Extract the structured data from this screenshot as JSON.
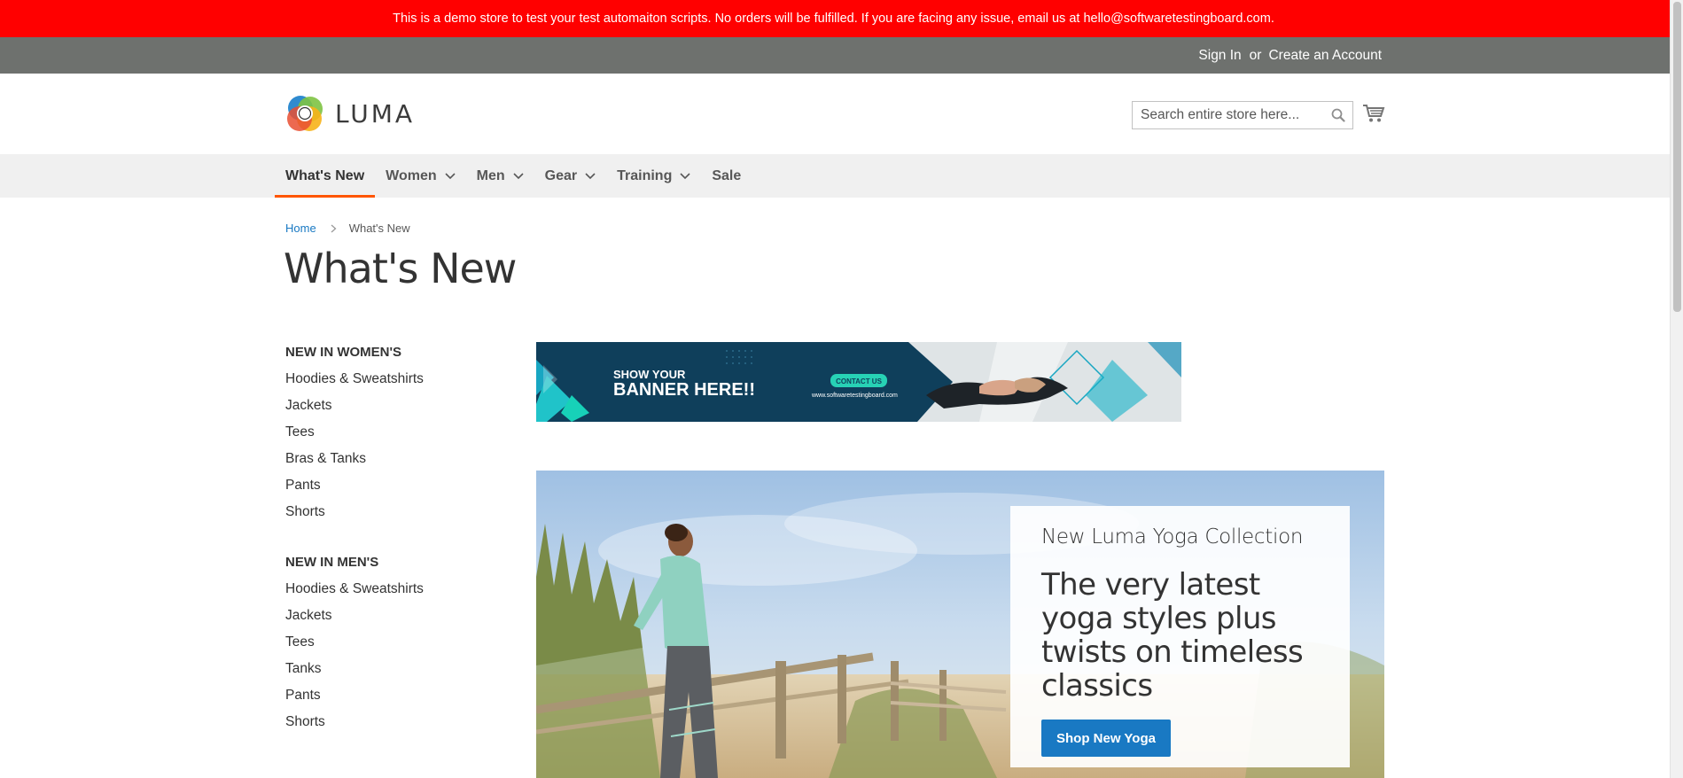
{
  "notice": {
    "text": "This is a demo store to test your test automaiton scripts. No orders will be fulfilled. If you are facing any issue, email us at hello@softwaretestingboard.com."
  },
  "panel": {
    "sign_in": "Sign In",
    "or": "or",
    "create_account": "Create an Account"
  },
  "header": {
    "logo_text": "LUMA",
    "search": {
      "placeholder": "Search entire store here...",
      "value": ""
    },
    "cart_icon": "shopping-cart-icon",
    "search_icon": "magnifier-icon"
  },
  "nav": {
    "items": [
      {
        "label": "What's New",
        "active": true
      },
      {
        "label": "Women"
      },
      {
        "label": "Men"
      },
      {
        "label": "Gear"
      },
      {
        "label": "Training"
      },
      {
        "label": "Sale"
      }
    ]
  },
  "breadcrumb": {
    "home": "Home",
    "current": "What's New"
  },
  "page": {
    "title": "What's New"
  },
  "sidebar": {
    "sections": [
      {
        "title": "NEW IN WOMEN'S",
        "items": [
          "Hoodies & Sweatshirts",
          "Jackets",
          "Tees",
          "Bras & Tanks",
          "Pants",
          "Shorts"
        ]
      },
      {
        "title": "NEW IN MEN'S",
        "items": [
          "Hoodies & Sweatshirts",
          "Jackets",
          "Tees",
          "Tanks",
          "Pants",
          "Shorts"
        ]
      }
    ]
  },
  "banner": {
    "line1": "SHOW YOUR",
    "line2": "BANNER HERE!!",
    "cta": "CONTACT US",
    "url": "www.softwaretestingboard.com"
  },
  "hero": {
    "subtitle": "New Luma Yoga Collection",
    "headline": "The very latest yoga styles plus twists on timeless classics",
    "button": "Shop New Yoga"
  },
  "colors": {
    "notice_bg": "#ff0000",
    "panel_bg": "#6e716e",
    "nav_bg": "#f0f0f0",
    "accent": "#ff5501",
    "link": "#1979c3",
    "button": "#1979c3"
  }
}
